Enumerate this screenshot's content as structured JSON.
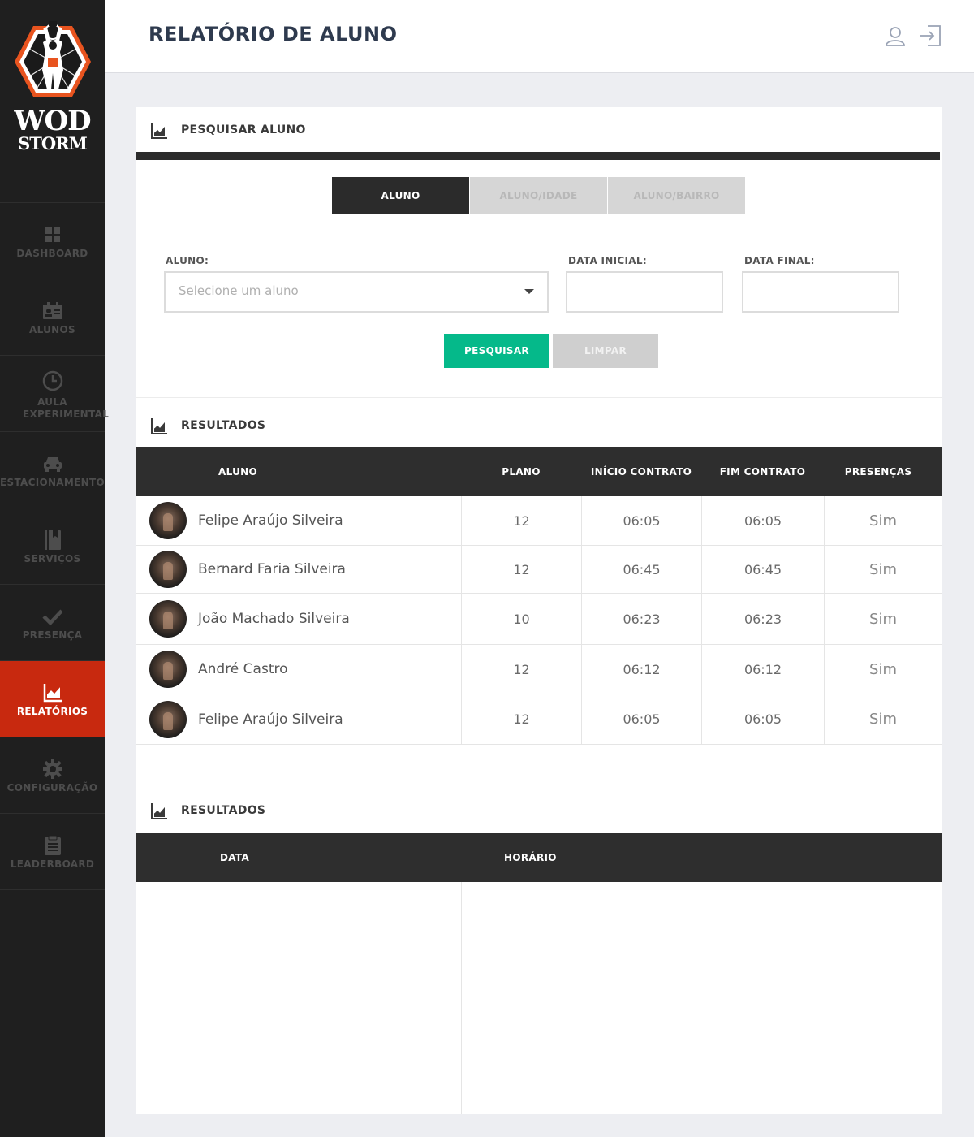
{
  "brand": {
    "line1": "WOD",
    "line2": "STORM",
    "accent": "#e8541f"
  },
  "sidebar": {
    "items": [
      {
        "label": "DASHBOARD",
        "icon": "grid-icon"
      },
      {
        "label": "ALUNOS",
        "icon": "id-card-icon"
      },
      {
        "label": "AULA EXPERIMENTAL",
        "icon": "clock-icon"
      },
      {
        "label": "ESTACIONAMENTO",
        "icon": "car-icon"
      },
      {
        "label": "SERVIÇOS",
        "icon": "book-icon"
      },
      {
        "label": "PRESENÇA",
        "icon": "check-icon"
      },
      {
        "label": "RELATÓRIOS",
        "icon": "chart-icon",
        "active": true
      },
      {
        "label": "CONFIGURAÇÃO",
        "icon": "gear-icon"
      },
      {
        "label": "LEADERBOARD",
        "icon": "clipboard-icon"
      }
    ],
    "active_color": "#c8290f"
  },
  "header": {
    "title": "RELATÓRIO DE ALUNO"
  },
  "search": {
    "title": "PESQUISAR ALUNO",
    "tabs": [
      "ALUNO",
      "ALUNO/IDADE",
      "ALUNO/BAIRRO"
    ],
    "aluno_label": "ALUNO:",
    "aluno_placeholder": "Selecione um aluno",
    "data_inicial_label": "DATA INICIAL:",
    "data_final_label": "DATA FINAL:",
    "search_button": "PESQUISAR",
    "clear_button": "LIMPAR",
    "search_color": "#05b98a"
  },
  "results1": {
    "title": "RESULTADOS",
    "headers": [
      "ALUNO",
      "PLANO",
      "INÍCIO CONTRATO",
      "FIM CONTRATO",
      "PRESENÇAS"
    ],
    "rows": [
      {
        "name": "Felipe Araújo Silveira",
        "plano": "12",
        "inicio": "06:05",
        "fim": "06:05",
        "presencas": "Sim"
      },
      {
        "name": "Bernard Faria Silveira",
        "plano": "12",
        "inicio": "06:45",
        "fim": "06:45",
        "presencas": "Sim"
      },
      {
        "name": "João Machado Silveira",
        "plano": "10",
        "inicio": "06:23",
        "fim": "06:23",
        "presencas": "Sim"
      },
      {
        "name": "André Castro",
        "plano": "12",
        "inicio": "06:12",
        "fim": "06:12",
        "presencas": "Sim"
      },
      {
        "name": "Felipe Araújo Silveira",
        "plano": "12",
        "inicio": "06:05",
        "fim": "06:05",
        "presencas": "Sim"
      }
    ]
  },
  "results2": {
    "title": "RESULTADOS",
    "headers": [
      "DATA",
      "HORÁRIO"
    ]
  }
}
